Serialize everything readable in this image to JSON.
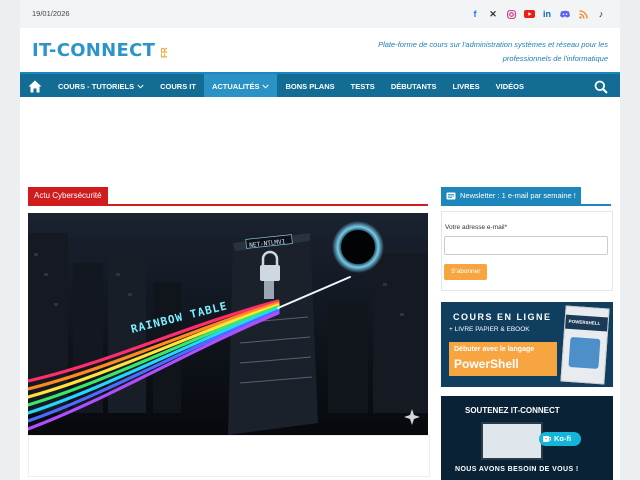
{
  "topbar": {
    "date": "19/01/2026",
    "social_icons": [
      "facebook-icon",
      "x-icon",
      "instagram-icon",
      "youtube-icon",
      "linkedin-icon",
      "discord-icon",
      "rss-icon",
      "tiktok-icon"
    ]
  },
  "header": {
    "logo": "IT-CONNECT",
    "logo_suffix": "FR",
    "tagline": "Plate-forme de cours sur l'administration systèmes et réseau pour les professionnels de l'informatique"
  },
  "nav": {
    "items": [
      {
        "label": "COURS - TUTORIELS",
        "dropdown": true
      },
      {
        "label": "COURS IT",
        "dropdown": false
      },
      {
        "label": "ACTUALITÉS",
        "dropdown": true,
        "active": true
      },
      {
        "label": "BONS PLANS",
        "dropdown": false
      },
      {
        "label": "TESTS",
        "dropdown": false
      },
      {
        "label": "DÉBUTANTS",
        "dropdown": false
      },
      {
        "label": "LIVRES",
        "dropdown": false
      },
      {
        "label": "VIDÉOS",
        "dropdown": false
      }
    ]
  },
  "main": {
    "category": "Actu Cybersécurité",
    "hero": {
      "server_label": "NET-NTLMV1",
      "beam_label": "RAINBOW TABLE"
    }
  },
  "sidebar": {
    "newsletter": {
      "title": "Newsletter : 1 e-mail par semaine !",
      "field_label": "Votre adresse e-mail*",
      "button": "S'abonner"
    },
    "banner1": {
      "line1": "COURS EN LIGNE",
      "line2": "+ LIVRE PAPIER & EBOOK",
      "line3": "Débuter avec le langage",
      "line4": "PowerShell",
      "book_title": "POWERSHELL"
    },
    "banner2": {
      "line1": "SOUTENEZ IT-CONNECT",
      "brand": "Ko-fi",
      "line2": "NOUS AVONS BESOIN DE VOUS !"
    }
  },
  "colors": {
    "nav_bg": "#136c93",
    "nav_active": "#2a92c4",
    "category_red": "#d01c1c",
    "newsletter_blue": "#1d87bb",
    "button_orange": "#f7a540"
  }
}
